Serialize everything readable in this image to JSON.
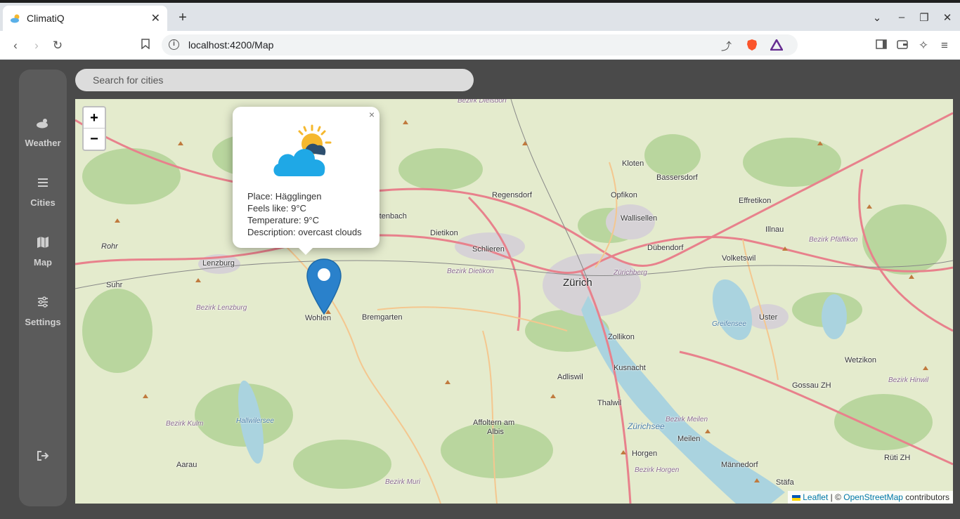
{
  "browser": {
    "tab_title": "ClimatiQ",
    "url": "localhost:4200/Map"
  },
  "sidebar": {
    "items": [
      {
        "label": "Weather",
        "icon": "cloud-sun-icon"
      },
      {
        "label": "Cities",
        "icon": "list-icon"
      },
      {
        "label": "Map",
        "icon": "map-icon"
      },
      {
        "label": "Settings",
        "icon": "sliders-icon"
      }
    ],
    "logout_icon": "logout-icon"
  },
  "search": {
    "placeholder": "Search for cities"
  },
  "map": {
    "zoom_in": "+",
    "zoom_out": "−",
    "popup": {
      "close": "×",
      "place": "Place: Hägglingen",
      "feels_like": "Feels like: 9°C",
      "temperature": "Temperature: 9°C",
      "description": "Description: overcast clouds"
    },
    "labels": {
      "zurich": "Zürich",
      "kloten": "Kloten",
      "bassersdorf": "Bassersdorf",
      "effretikon": "Effretikon",
      "regensdorf": "Regensdorf",
      "opfikon": "Opfikon",
      "wallisellen": "Wallisellen",
      "illnau": "Illnau",
      "spreitenbach": "Spreitenbach",
      "dietikon": "Dietikon",
      "schlieren": "Schlieren",
      "dubendorf": "Dübendorf",
      "volketswil": "Volketswil",
      "lenzburg": "Lenzburg",
      "suhr": "Suhr",
      "wohlen": "Wohlen",
      "bremgarten": "Bremgarten",
      "uster": "Uster",
      "zollikon": "Zollikon",
      "kusnacht": "Kusnacht",
      "adliswil": "Adliswil",
      "thalwil": "Thalwil",
      "wetzikon": "Wetzikon",
      "gossau": "Gossau ZH",
      "affoltern": "Affoltern am",
      "albis": "Albis",
      "horgen": "Horgen",
      "meilen": "Meilen",
      "mannedorf": "Männedorf",
      "stafa": "Stäfa",
      "ruti": "Rüti ZH",
      "aarau": "Aarau",
      "rohr": "Rohr",
      "bezirk_dietikon": "Bezirk Dietikon",
      "bezirk_lenzburg": "Bezirk Lenzburg",
      "bezirk_pfaffikon": "Bezirk Pfäffikon",
      "bezirk_hinwil": "Bezirk Hinwil",
      "bezirk_kulm": "Bezirk Kulm",
      "bezirk_muri": "Bezirk Muri",
      "bezirk_meilen": "Bezirk Meilen",
      "bezirk_horgen": "Bezirk Horgen",
      "bezirk_dielsdorf": "Bezirk Dielsdorf",
      "zurichberg": "Zürichberg",
      "greifensee": "Greifensee",
      "hallwilersee": "Hallwilersee",
      "zurichsee": "Zürichsee"
    },
    "attribution": {
      "leaflet": "Leaflet",
      "sep": " | © ",
      "osm": "OpenStreetMap",
      "contributors": " contributors"
    }
  }
}
